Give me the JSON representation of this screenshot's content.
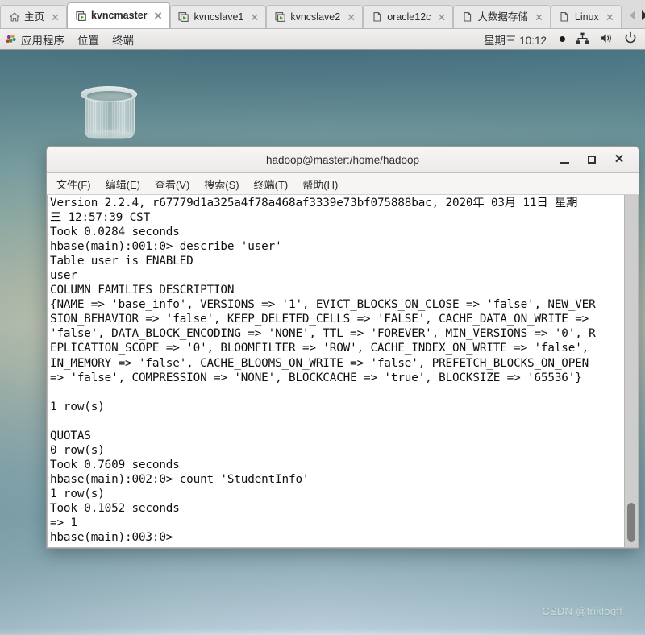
{
  "browser": {
    "tabs": [
      {
        "label": "主页",
        "icon": "home-icon",
        "active": false,
        "closable": true
      },
      {
        "label": "kvncmaster",
        "icon": "vnc-screen-icon",
        "active": true,
        "closable": true
      },
      {
        "label": "kvncslave1",
        "icon": "vnc-screen-icon",
        "active": false,
        "closable": true
      },
      {
        "label": "kvncslave2",
        "icon": "vnc-screen-icon",
        "active": false,
        "closable": true
      },
      {
        "label": "oracle12c",
        "icon": "page-icon",
        "active": false,
        "closable": true
      },
      {
        "label": "大数据存储",
        "icon": "page-icon",
        "active": false,
        "closable": true
      },
      {
        "label": "Linux",
        "icon": "page-icon",
        "active": false,
        "closable": true
      }
    ],
    "nav": {
      "prev": "scroll-tabs-left",
      "next": "scroll-tabs-right"
    }
  },
  "panel": {
    "menus": [
      {
        "label": "应用程序",
        "icon": "gnome-foot-icon"
      },
      {
        "label": "位置",
        "icon": ""
      },
      {
        "label": "终端",
        "icon": ""
      }
    ],
    "clock": "星期三 10:12",
    "tray": [
      {
        "name": "network-icon"
      },
      {
        "name": "volume-icon"
      },
      {
        "name": "power-icon"
      }
    ]
  },
  "desktop": {
    "icons": [
      {
        "name": "trash-icon",
        "label": ""
      }
    ],
    "watermark": "CSDN @friklogff"
  },
  "terminal": {
    "title": "hadoop@master:/home/hadoop",
    "window_buttons": {
      "minimize": "minimize-button",
      "maximize": "maximize-button",
      "close": "close-button"
    },
    "menubar": [
      "文件(F)",
      "编辑(E)",
      "查看(V)",
      "搜索(S)",
      "终端(T)",
      "帮助(H)"
    ],
    "content": "Version 2.2.4, r67779d1a325a4f78a468af3339e73bf075888bac, 2020年 03月 11日 星期\n三 12:57:39 CST\nTook 0.0284 seconds\nhbase(main):001:0> describe 'user'\nTable user is ENABLED\nuser\nCOLUMN FAMILIES DESCRIPTION\n{NAME => 'base_info', VERSIONS => '1', EVICT_BLOCKS_ON_CLOSE => 'false', NEW_VER\nSION_BEHAVIOR => 'false', KEEP_DELETED_CELLS => 'FALSE', CACHE_DATA_ON_WRITE =>\n'false', DATA_BLOCK_ENCODING => 'NONE', TTL => 'FOREVER', MIN_VERSIONS => '0', R\nEPLICATION_SCOPE => '0', BLOOMFILTER => 'ROW', CACHE_INDEX_ON_WRITE => 'false',\nIN_MEMORY => 'false', CACHE_BLOOMS_ON_WRITE => 'false', PREFETCH_BLOCKS_ON_OPEN\n=> 'false', COMPRESSION => 'NONE', BLOCKCACHE => 'true', BLOCKSIZE => '65536'}\n\n1 row(s)\n\nQUOTAS\n0 row(s)\nTook 0.7609 seconds\nhbase(main):002:0> count 'StudentInfo'\n1 row(s)\nTook 0.1052 seconds\n=> 1\nhbase(main):003:0>",
    "scrollbar": {
      "name": "terminal-scrollbar"
    }
  }
}
